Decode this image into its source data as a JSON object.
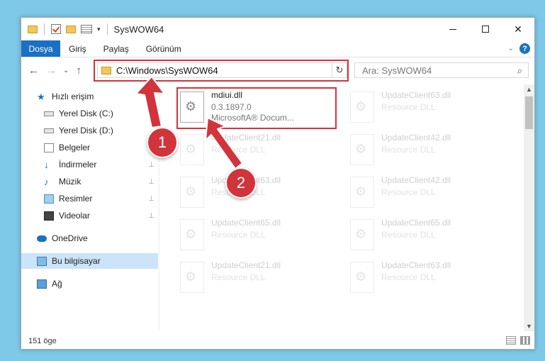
{
  "window": {
    "title": "SysWOW64",
    "controls": {
      "minimize": "—",
      "maximize": "☐",
      "close": "✕"
    }
  },
  "ribbon": {
    "tabs": [
      "Dosya",
      "Giriş",
      "Paylaş",
      "Görünüm"
    ],
    "accent": "#1a70c4",
    "help_label": "?"
  },
  "nav": {
    "back_icon": "←",
    "forward_icon": "→",
    "recent_icon": "⌄",
    "up_icon": "↑",
    "address": "C:\\Windows\\SysWOW64",
    "refresh_icon": "↻",
    "search_placeholder": "Ara: SysWOW64",
    "search_icon": "⌕"
  },
  "sidebar": {
    "items": [
      {
        "label": "Hızlı erişim",
        "icon": "star-icon",
        "pinned": false
      },
      {
        "label": "Yerel Disk (C:)",
        "icon": "disk-icon",
        "pinned": false
      },
      {
        "label": "Yerel Disk (D:)",
        "icon": "disk-icon",
        "pinned": false
      },
      {
        "label": "Belgeler",
        "icon": "document-icon",
        "pinned": false
      },
      {
        "label": "İndirmeler",
        "icon": "download-icon",
        "pinned": true
      },
      {
        "label": "Müzik",
        "icon": "music-icon",
        "pinned": true
      },
      {
        "label": "Resimler",
        "icon": "pictures-icon",
        "pinned": true
      },
      {
        "label": "Videolar",
        "icon": "video-icon",
        "pinned": true
      },
      {
        "label": "OneDrive",
        "icon": "cloud-icon",
        "pinned": false
      },
      {
        "label": "Bu bilgisayar",
        "icon": "computer-icon",
        "pinned": false,
        "selected": true
      },
      {
        "label": "Ağ",
        "icon": "network-icon",
        "pinned": false
      }
    ],
    "pin_glyph": "📌"
  },
  "files": {
    "highlighted": {
      "name": "mdiui.dll",
      "version": "0.3.1897.0",
      "description": "MicrosoftA® Docum..."
    },
    "faded": [
      {
        "name": "UpdateClient63.dll",
        "sub": "Resource DLL"
      },
      {
        "name": "UpdateClient21.dll",
        "sub": "Resource DLL"
      },
      {
        "name": "UpdateClient42.dll",
        "sub": "Resource DLL"
      },
      {
        "name": "UpdateClient63.dll",
        "sub": "Resource DLL"
      },
      {
        "name": "UpdateClient42.dll",
        "sub": "Resource DLL"
      },
      {
        "name": "UpdateClient65.dll",
        "sub": "Resource DLL"
      },
      {
        "name": "UpdateClient65.dll",
        "sub": "Resource DLL"
      },
      {
        "name": "UpdateClient21.dll",
        "sub": "Resource DLL"
      },
      {
        "name": "UpdateClient63.dll",
        "sub": "Resource DLL"
      }
    ]
  },
  "status": {
    "count": "151 öge"
  },
  "annotations": {
    "step1": "1",
    "step2": "2",
    "color": "#d2343b"
  }
}
